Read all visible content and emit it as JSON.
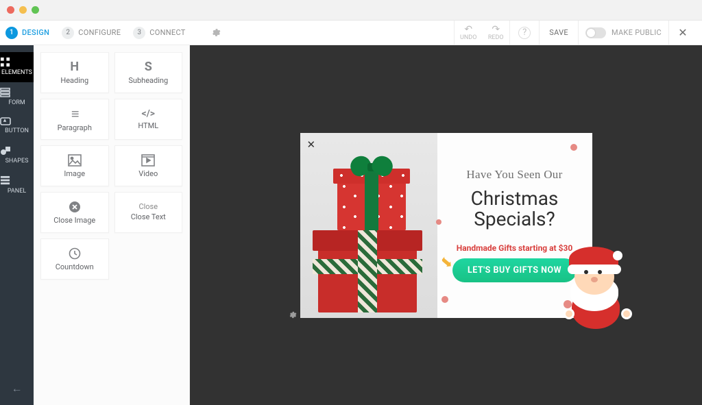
{
  "window": {
    "os_dots": [
      "#ed6a5e",
      "#f5bf4f",
      "#61c454"
    ]
  },
  "topbar": {
    "steps": [
      {
        "num": "1",
        "label": "DESIGN",
        "active": true
      },
      {
        "num": "2",
        "label": "CONFIGURE",
        "active": false
      },
      {
        "num": "3",
        "label": "CONNECT",
        "active": false
      }
    ],
    "gear_icon": "gear-icon",
    "undo": {
      "label": "UNDO"
    },
    "redo": {
      "label": "REDO"
    },
    "help_glyph": "?",
    "save_label": "SAVE",
    "make_public_label": "MAKE PUBLIC",
    "close_glyph": "✕"
  },
  "leftbar": {
    "items": [
      {
        "label": "ELEMENTS",
        "icon": "grid-icon",
        "active": true
      },
      {
        "label": "FORM",
        "icon": "form-icon",
        "active": false
      },
      {
        "label": "BUTTON",
        "icon": "button-icon",
        "active": false
      },
      {
        "label": "SHAPES",
        "icon": "shapes-icon",
        "active": false
      },
      {
        "label": "PANEL",
        "icon": "panel-icon",
        "active": false
      }
    ],
    "back_glyph": "←"
  },
  "elements_panel": {
    "cards": [
      {
        "icon": "H",
        "label": "Heading",
        "icon_kind": "letter"
      },
      {
        "icon": "S",
        "label": "Subheading",
        "icon_kind": "letter"
      },
      {
        "icon": "≡",
        "label": "Paragraph",
        "icon_kind": "glyph"
      },
      {
        "icon": "</>",
        "label": "HTML",
        "icon_kind": "glyph"
      },
      {
        "icon": "image-icon",
        "label": "Image",
        "icon_kind": "svg"
      },
      {
        "icon": "video-icon",
        "label": "Video",
        "icon_kind": "svg"
      },
      {
        "icon": "close-circle-icon",
        "label": "Close Image",
        "icon_kind": "svg"
      },
      {
        "icon": "",
        "top_label": "Close",
        "label": "Close Text",
        "icon_kind": "twoline"
      },
      {
        "icon": "clock-icon",
        "label": "Countdown",
        "icon_kind": "svg"
      }
    ]
  },
  "popup": {
    "close_glyph": "✕",
    "line1": "Have You Seen Our",
    "line2a": "Christmas",
    "line2b": "Specials?",
    "subtext": "Handmade Gifts starting at $30",
    "cta_label": "LET'S BUY GIFTS NOW",
    "accent_dot_color": "#e2756e",
    "cta_gradient": [
      "#1fd6a1",
      "#18c285"
    ]
  }
}
